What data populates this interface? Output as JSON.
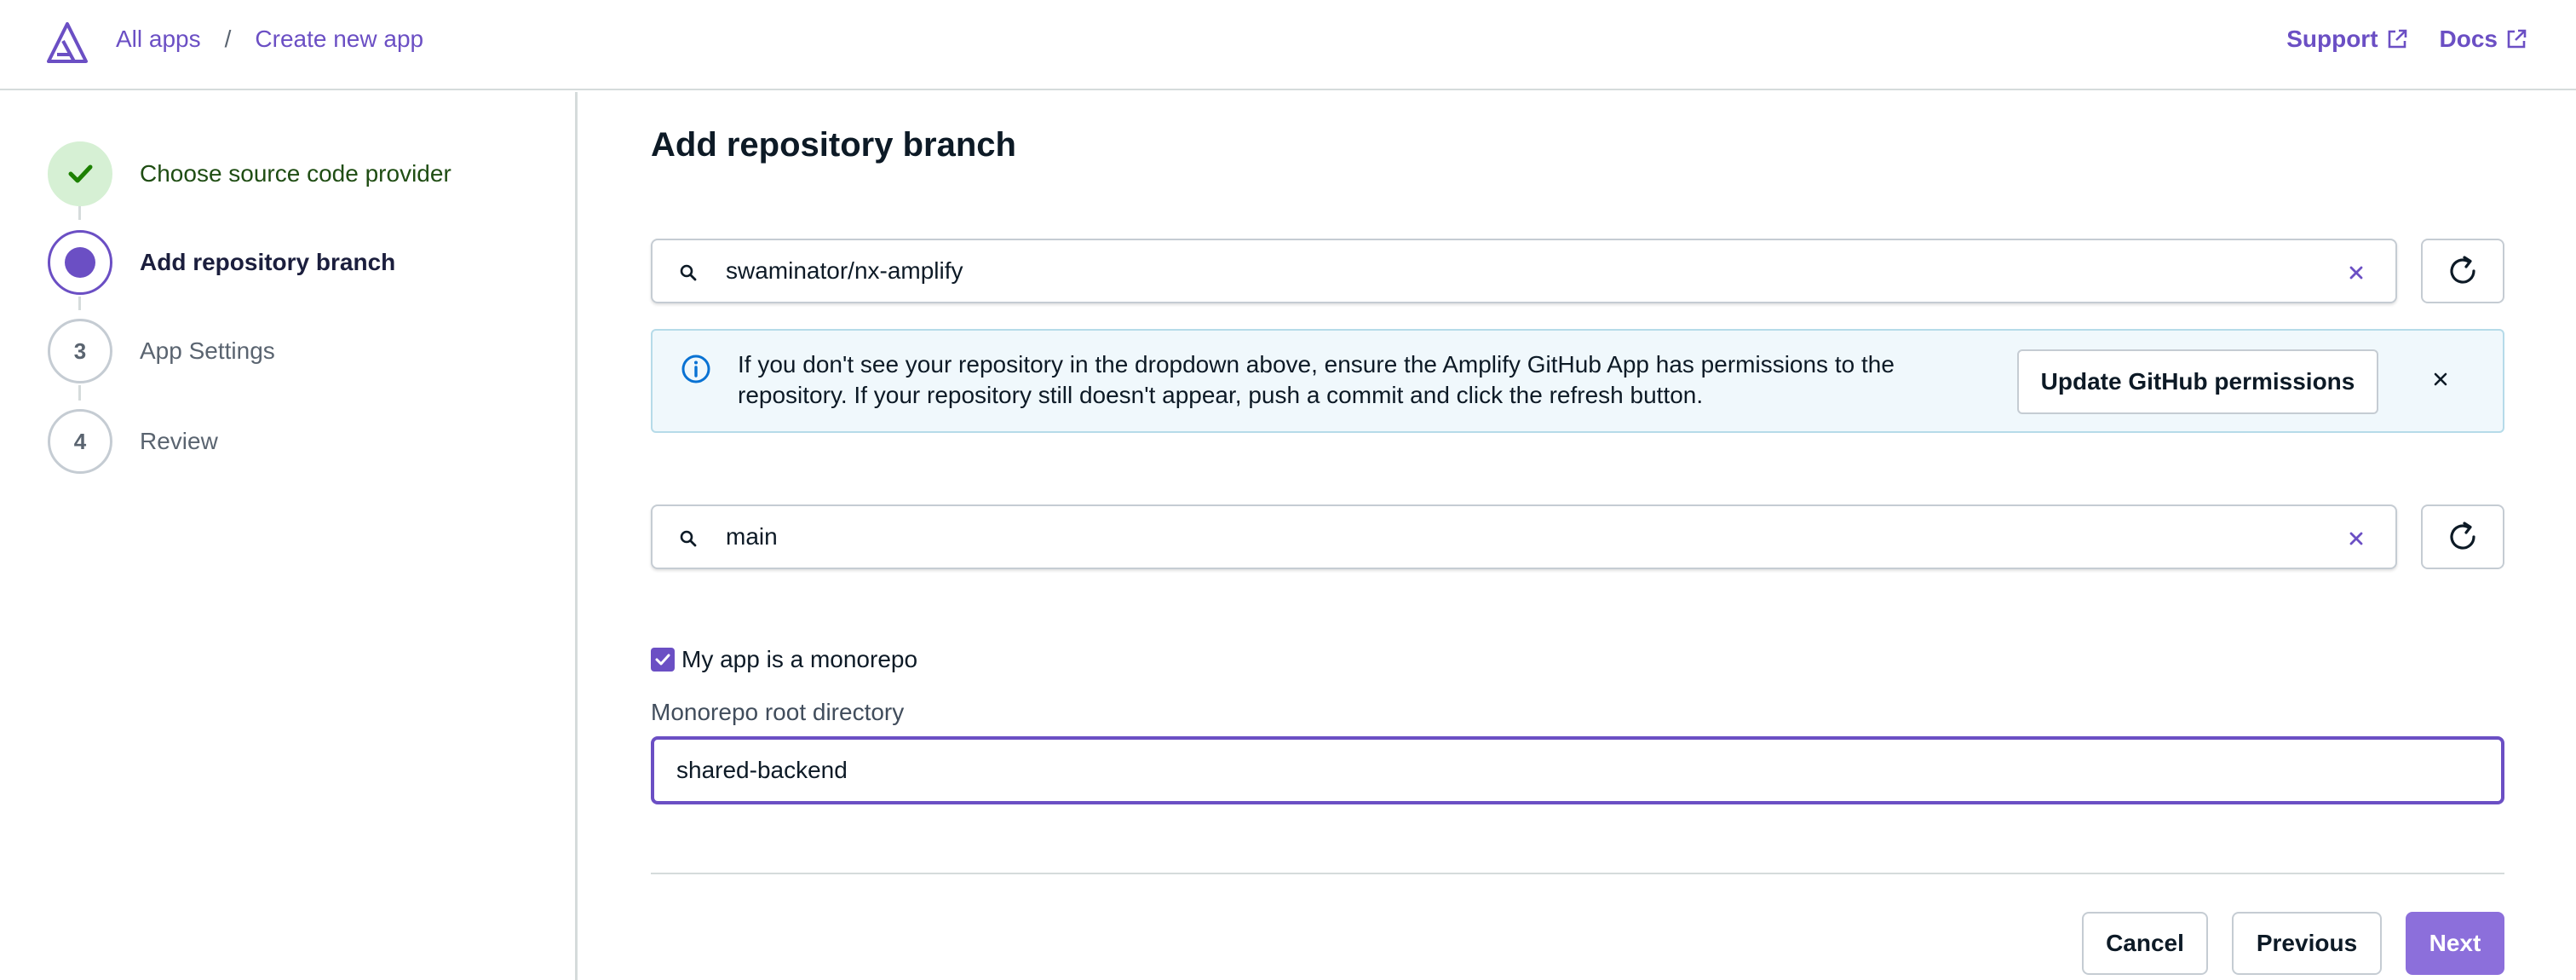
{
  "header": {
    "logo_icon": "amplify-logo-icon",
    "breadcrumbs": [
      "All apps",
      "Create new app"
    ],
    "separator": "/",
    "links": [
      {
        "label": "Support",
        "icon": "external-link-icon"
      },
      {
        "label": "Docs",
        "icon": "external-link-icon"
      }
    ]
  },
  "steps": [
    {
      "number": "1",
      "label": "Choose source code provider",
      "state": "done"
    },
    {
      "number": "2",
      "label": "Add repository branch",
      "state": "current"
    },
    {
      "number": "3",
      "label": "App Settings",
      "state": "todo"
    },
    {
      "number": "4",
      "label": "Review",
      "state": "todo"
    }
  ],
  "main": {
    "title": "Add repository branch",
    "repository_search": {
      "value": "swaminator/nx-amplify",
      "icon": "search-icon"
    },
    "alert": {
      "text": "If you don't see your repository in the dropdown above, ensure the Amplify GitHub App has permissions to the repository. If your repository still doesn't appear, push a commit and click the refresh button.",
      "button_label": "Update GitHub permissions",
      "icon": "info-icon"
    },
    "branch_search": {
      "value": "main",
      "icon": "search-icon"
    },
    "monorepo_checkbox": {
      "label": "My app is a monorepo",
      "checked": true
    },
    "monorepo_field": {
      "label": "Monorepo root directory",
      "value": "shared-backend"
    },
    "buttons": {
      "cancel": "Cancel",
      "previous": "Previous",
      "next": "Next"
    }
  },
  "colors": {
    "accent": "#6b4fc4",
    "next_button": "#8c6fdb",
    "done_step_bg": "#d6f0d4",
    "alert_bg": "#f0f8fc"
  }
}
